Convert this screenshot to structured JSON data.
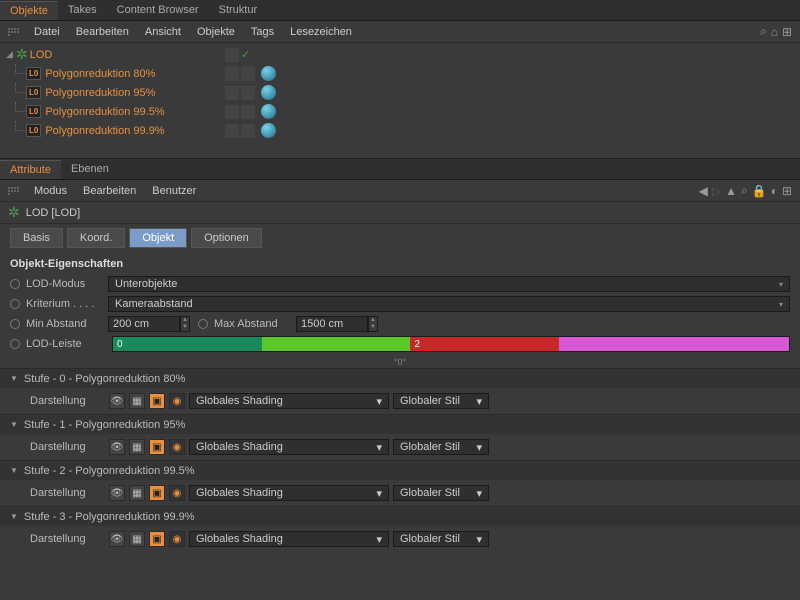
{
  "top_tabs": [
    "Objekte",
    "Takes",
    "Content Browser",
    "Struktur"
  ],
  "top_menu": [
    "Datei",
    "Bearbeiten",
    "Ansicht",
    "Objekte",
    "Tags",
    "Lesezeichen"
  ],
  "tree": {
    "root": "LOD",
    "children": [
      "Polygonreduktion 80%",
      "Polygonreduktion 95%",
      "Polygonreduktion 99.5%",
      "Polygonreduktion 99.9%"
    ],
    "lo_badge": "L0"
  },
  "bottom_tabs": [
    "Attribute",
    "Ebenen"
  ],
  "bottom_menu": [
    "Modus",
    "Bearbeiten",
    "Benutzer"
  ],
  "object_title": "LOD [LOD]",
  "sub_tabs": [
    "Basis",
    "Koord.",
    "Objekt",
    "Optionen"
  ],
  "section": "Objekt-Eigenschaften",
  "props": {
    "lod_modus_label": "LOD-Modus",
    "lod_modus_value": "Unterobjekte",
    "kriterium_label": "Kriterium . . . .",
    "kriterium_value": "Kameraabstand",
    "min_abstand_label": "Min Abstand",
    "min_abstand_value": "200 cm",
    "max_abstand_label": "Max Abstand",
    "max_abstand_value": "1500 cm",
    "lod_leiste_label": "LOD-Leiste",
    "seg0": "0",
    "seg2": "2",
    "grade": "°0°"
  },
  "stufen": [
    {
      "title": "Stufe - 0 - Polygonreduktion 80%"
    },
    {
      "title": "Stufe - 1 - Polygonreduktion 95%"
    },
    {
      "title": "Stufe - 2 - Polygonreduktion 99.5%"
    },
    {
      "title": "Stufe - 3 - Polygonreduktion 99.9%"
    }
  ],
  "darstellung_label": "Darstellung",
  "shading_value": "Globales Shading",
  "stil_value": "Globaler Stil"
}
